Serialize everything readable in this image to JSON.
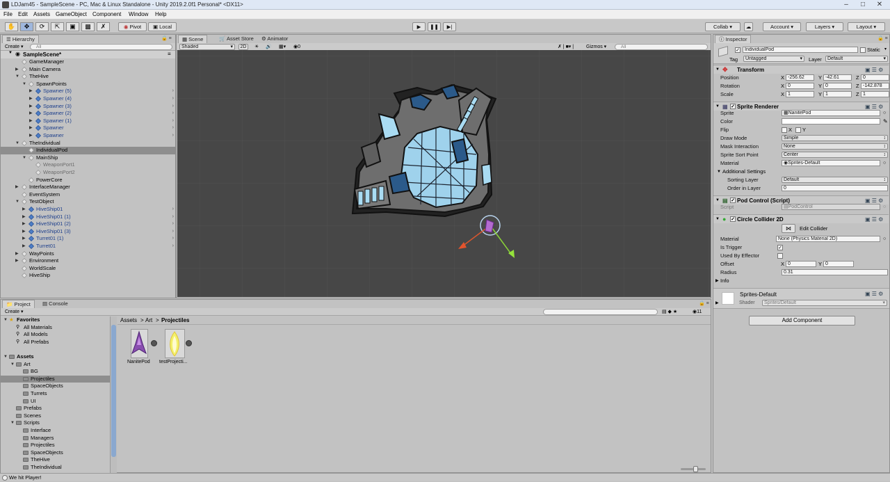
{
  "window": {
    "title": "LDJam45 - SampleScene - PC, Mac & Linux Standalone - Unity 2019.2.0f1 Personal* <DX11>"
  },
  "menu": [
    "File",
    "Edit",
    "Assets",
    "GameObject",
    "Component",
    "Window",
    "Help"
  ],
  "toolbar": {
    "pivot": "Pivot",
    "local": "Local",
    "collab": "Collab ▾",
    "account": "Account",
    "layers": "Layers",
    "layout": "Layout"
  },
  "hierarchy": {
    "tab": "Hierarchy",
    "create": "Create",
    "search": "All",
    "scene": "SampleScene*",
    "items": [
      {
        "label": "GameManager",
        "depth": 1,
        "icon": "go",
        "arrow": "",
        "style": ""
      },
      {
        "label": "Main Camera",
        "depth": 1,
        "icon": "go",
        "arrow": "▶",
        "style": ""
      },
      {
        "label": "TheHive",
        "depth": 1,
        "icon": "go",
        "arrow": "▼",
        "style": ""
      },
      {
        "label": "SpawnPoints",
        "depth": 2,
        "icon": "go",
        "arrow": "▼",
        "style": ""
      },
      {
        "label": "Spawner (5)",
        "depth": 3,
        "icon": "pre",
        "arrow": "▶",
        "style": "blue",
        "chev": true
      },
      {
        "label": "Spawner (4)",
        "depth": 3,
        "icon": "pre",
        "arrow": "▶",
        "style": "blue",
        "chev": true
      },
      {
        "label": "Spawner (3)",
        "depth": 3,
        "icon": "pre",
        "arrow": "▶",
        "style": "blue",
        "chev": true
      },
      {
        "label": "Spawner (2)",
        "depth": 3,
        "icon": "pre",
        "arrow": "▶",
        "style": "blue",
        "chev": true
      },
      {
        "label": "Spawner (1)",
        "depth": 3,
        "icon": "pre",
        "arrow": "▶",
        "style": "blue",
        "chev": true
      },
      {
        "label": "Spawner",
        "depth": 3,
        "icon": "pre",
        "arrow": "▶",
        "style": "blue",
        "chev": true
      },
      {
        "label": "Spawner",
        "depth": 3,
        "icon": "pre",
        "arrow": "▶",
        "style": "blue",
        "chev": true
      },
      {
        "label": "TheIndividual",
        "depth": 1,
        "icon": "go",
        "arrow": "▼",
        "style": ""
      },
      {
        "label": "IndividualPod",
        "depth": 2,
        "icon": "go",
        "arrow": "",
        "style": "",
        "sel": true
      },
      {
        "label": "MainShip",
        "depth": 2,
        "icon": "go",
        "arrow": "▼",
        "style": ""
      },
      {
        "label": "WeaponPort1",
        "depth": 3,
        "icon": "go",
        "arrow": "",
        "style": "grey"
      },
      {
        "label": "WeaponPort2",
        "depth": 3,
        "icon": "go",
        "arrow": "",
        "style": "grey"
      },
      {
        "label": "PowerCore",
        "depth": 2,
        "icon": "go",
        "arrow": "",
        "style": ""
      },
      {
        "label": "InterfaceManager",
        "depth": 1,
        "icon": "go",
        "arrow": "▶",
        "style": ""
      },
      {
        "label": "EventSystem",
        "depth": 1,
        "icon": "go",
        "arrow": "",
        "style": ""
      },
      {
        "label": "TestObject",
        "depth": 1,
        "icon": "go",
        "arrow": "▼",
        "style": ""
      },
      {
        "label": "HiveShip01",
        "depth": 2,
        "icon": "pre",
        "arrow": "▶",
        "style": "blue",
        "chev": true
      },
      {
        "label": "HiveShip01 (1)",
        "depth": 2,
        "icon": "pre",
        "arrow": "▶",
        "style": "blue",
        "chev": true
      },
      {
        "label": "HiveShip01 (2)",
        "depth": 2,
        "icon": "pre",
        "arrow": "▶",
        "style": "blue",
        "chev": true
      },
      {
        "label": "HiveShip01 (3)",
        "depth": 2,
        "icon": "pre",
        "arrow": "▶",
        "style": "blue",
        "chev": true
      },
      {
        "label": "Turret01 (1)",
        "depth": 2,
        "icon": "pre",
        "arrow": "▶",
        "style": "blue",
        "chev": true
      },
      {
        "label": "Turret01",
        "depth": 2,
        "icon": "pre",
        "arrow": "▶",
        "style": "blue",
        "chev": true
      },
      {
        "label": "WayPoints",
        "depth": 1,
        "icon": "go",
        "arrow": "▶",
        "style": ""
      },
      {
        "label": "Environment",
        "depth": 1,
        "icon": "go",
        "arrow": "▶",
        "style": ""
      },
      {
        "label": "WorldScale",
        "depth": 1,
        "icon": "go",
        "arrow": "",
        "style": ""
      },
      {
        "label": "HiveShip",
        "depth": 1,
        "icon": "go",
        "arrow": "",
        "style": ""
      }
    ]
  },
  "scene_tabs": [
    "Scene",
    "Asset Store",
    "Animator"
  ],
  "scene_bar": {
    "shading": "Shaded",
    "mode2d": "2D",
    "fx_count": "0",
    "gizmos": "Gizmos",
    "search": "All"
  },
  "project": {
    "tabs": [
      "Project",
      "Console"
    ],
    "create": "Create",
    "breadcrumb": [
      "Assets",
      "Art",
      "Projectiles"
    ],
    "count": "11",
    "tree": [
      {
        "label": "Favorites",
        "depth": 0,
        "arrow": "▼",
        "bold": true,
        "icon": "star"
      },
      {
        "label": "All Materials",
        "depth": 1,
        "arrow": "",
        "icon": "search"
      },
      {
        "label": "All Models",
        "depth": 1,
        "arrow": "",
        "icon": "search"
      },
      {
        "label": "All Prefabs",
        "depth": 1,
        "arrow": "",
        "icon": "search"
      },
      {
        "label": "",
        "depth": 0,
        "arrow": "",
        "icon": "none"
      },
      {
        "label": "Assets",
        "depth": 0,
        "arrow": "▼",
        "bold": true,
        "icon": "fld"
      },
      {
        "label": "Art",
        "depth": 1,
        "arrow": "▼",
        "icon": "fld"
      },
      {
        "label": "BG",
        "depth": 2,
        "arrow": "",
        "icon": "fld"
      },
      {
        "label": "Projectiles",
        "depth": 2,
        "arrow": "",
        "icon": "fld",
        "sel": true
      },
      {
        "label": "SpaceObjects",
        "depth": 2,
        "arrow": "",
        "icon": "fld"
      },
      {
        "label": "Turrets",
        "depth": 2,
        "arrow": "",
        "icon": "fld"
      },
      {
        "label": "UI",
        "depth": 2,
        "arrow": "",
        "icon": "fld"
      },
      {
        "label": "Prefabs",
        "depth": 1,
        "arrow": "",
        "icon": "fld"
      },
      {
        "label": "Scenes",
        "depth": 1,
        "arrow": "",
        "icon": "fld"
      },
      {
        "label": "Scripts",
        "depth": 1,
        "arrow": "▼",
        "icon": "fld"
      },
      {
        "label": "Interface",
        "depth": 2,
        "arrow": "",
        "icon": "fld"
      },
      {
        "label": "Managers",
        "depth": 2,
        "arrow": "",
        "icon": "fld"
      },
      {
        "label": "Projectiles",
        "depth": 2,
        "arrow": "",
        "icon": "fld"
      },
      {
        "label": "SpaceObjects",
        "depth": 2,
        "arrow": "",
        "icon": "fld"
      },
      {
        "label": "TheHive",
        "depth": 2,
        "arrow": "",
        "icon": "fld"
      },
      {
        "label": "TheIndividual",
        "depth": 2,
        "arrow": "",
        "icon": "fld"
      }
    ],
    "assets": [
      {
        "label": "NanitePod",
        "kind": "pod"
      },
      {
        "label": "testProjecti...",
        "kind": "flame"
      }
    ]
  },
  "inspector": {
    "tab": "Inspector",
    "object": "IndividualPod",
    "static": "Static",
    "tag_label": "Tag",
    "tag": "Untagged",
    "layer_label": "Layer",
    "layer": "Default",
    "transform": {
      "title": "Transform",
      "rows": [
        {
          "k": "Position",
          "x": "-256.62",
          "y": "-42.61",
          "z": "0"
        },
        {
          "k": "Rotation",
          "x": "0",
          "y": "0",
          "z": "-142.878"
        },
        {
          "k": "Scale",
          "x": "1",
          "y": "1",
          "z": "1"
        }
      ]
    },
    "sprite_renderer": {
      "title": "Sprite Renderer",
      "sprite_label": "Sprite",
      "sprite": "NanitePod",
      "color_label": "Color",
      "flip_label": "Flip",
      "flip_x": "X",
      "flip_y": "Y",
      "draw_mode_label": "Draw Mode",
      "draw_mode": "Simple",
      "mask_label": "Mask Interaction",
      "mask": "None",
      "sort_point_label": "Sprite Sort Point",
      "sort_point": "Center",
      "material_label": "Material",
      "material": "Sprites-Default",
      "additional": "Additional Settings",
      "sorting_layer_label": "Sorting Layer",
      "sorting_layer": "Default",
      "order_label": "Order in Layer",
      "order": "0"
    },
    "pod_control": {
      "title": "Pod Control (Script)",
      "script_label": "Script",
      "script": "PodControl"
    },
    "circle_collider": {
      "title": "Circle Collider 2D",
      "edit": "Edit Collider",
      "material_label": "Material",
      "material": "None (Physics Material 2D)",
      "trigger_label": "Is Trigger",
      "effector_label": "Used By Effector",
      "offset_label": "Offset",
      "offset_x": "0",
      "offset_y": "0",
      "radius_label": "Radius",
      "radius": "0.31",
      "info": "Info"
    },
    "material": {
      "name": "Sprites-Default",
      "shader_label": "Shader",
      "shader": "Sprites/Default"
    },
    "add_component": "Add Component"
  },
  "status": {
    "message": "We hit Player!"
  }
}
